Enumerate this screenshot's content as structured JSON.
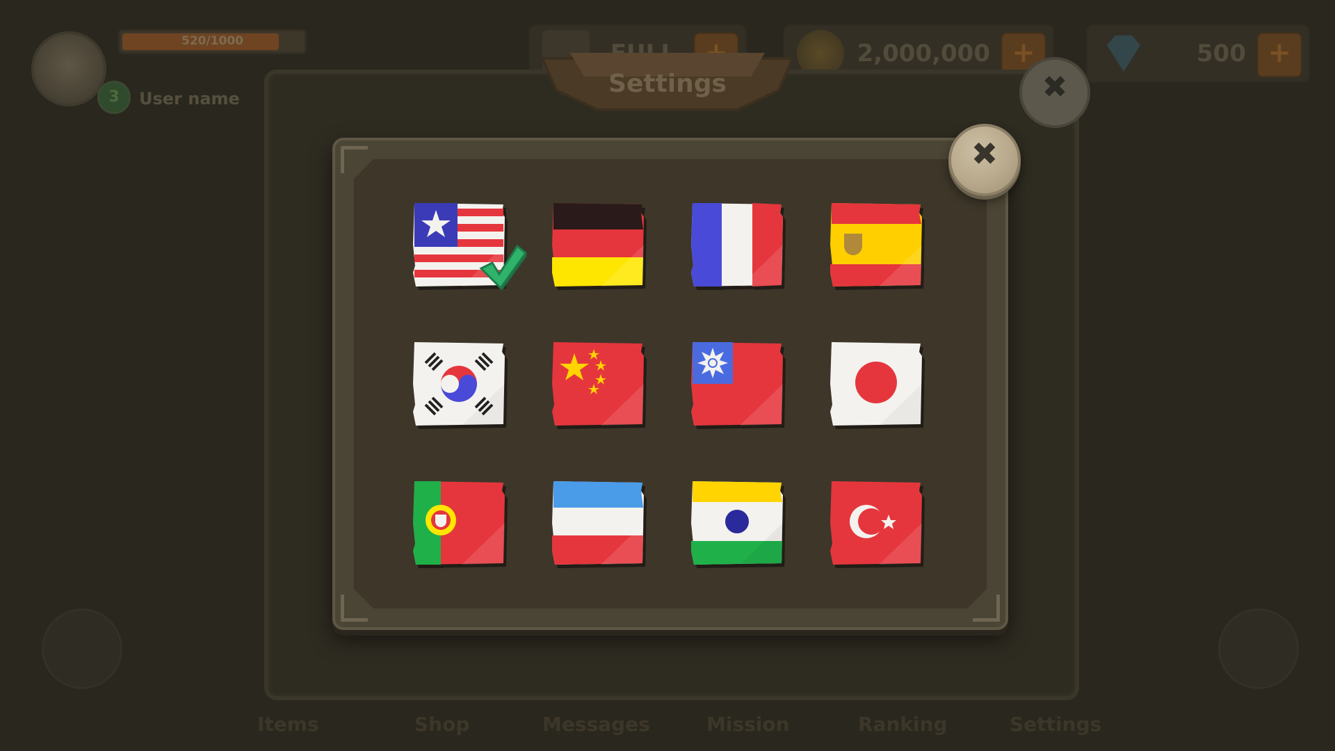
{
  "hud": {
    "xp_text": "520/1000",
    "level": "3",
    "username": "User name",
    "resource_1": "2,000,000",
    "resource_2": "500",
    "resource_0": "FULL"
  },
  "background_window": {
    "title": "Settings"
  },
  "nav": [
    {
      "label": "Items"
    },
    {
      "label": "Shop"
    },
    {
      "label": "Messages"
    },
    {
      "label": "Mission"
    },
    {
      "label": "Ranking"
    },
    {
      "label": "Settings"
    }
  ],
  "language_modal": {
    "close_icon": "close-icon",
    "selected": "usa",
    "flags": [
      {
        "name": "usa",
        "icon": "usa-flag-icon",
        "selected": true
      },
      {
        "name": "germany",
        "icon": "germany-flag-icon"
      },
      {
        "name": "france",
        "icon": "france-flag-icon"
      },
      {
        "name": "spain",
        "icon": "spain-flag-icon"
      },
      {
        "name": "south-korea",
        "icon": "south-korea-flag-icon"
      },
      {
        "name": "china",
        "icon": "china-flag-icon"
      },
      {
        "name": "taiwan",
        "icon": "taiwan-flag-icon"
      },
      {
        "name": "japan",
        "icon": "japan-flag-icon"
      },
      {
        "name": "portugal",
        "icon": "portugal-flag-icon"
      },
      {
        "name": "argentina",
        "icon": "argentina-flag-icon"
      },
      {
        "name": "india",
        "icon": "india-flag-icon"
      },
      {
        "name": "turkey",
        "icon": "turkey-flag-icon"
      }
    ]
  },
  "colors": {
    "backdrop": "#2a271e",
    "panel": "#3d3629",
    "panel_border": "#4b4535",
    "check_green": "#2fb36b",
    "flag_red": "#e5363d",
    "flag_white": "#f4f2ee"
  }
}
